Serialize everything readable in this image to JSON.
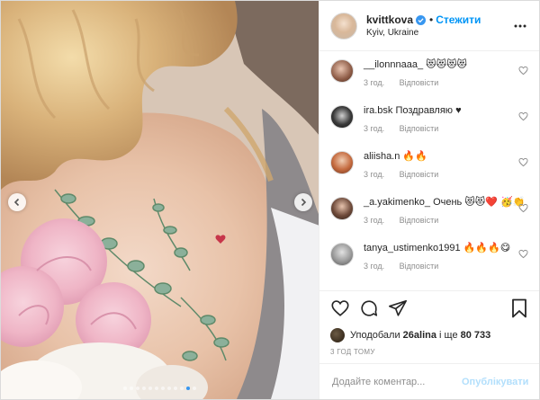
{
  "post": {
    "username": "kvittkova",
    "separator": "•",
    "follow_label": "Стежити",
    "location": "Kyiv, Ukraine",
    "accent": "#0095f6",
    "active_slide": 10,
    "slide_count": 12
  },
  "comments": [
    {
      "user": "__ilonnnaaa_",
      "text": "😻😻😻😻",
      "time": "3 год.",
      "reply": "Відповісти"
    },
    {
      "user": "ira.bsk",
      "text": "Поздравляю ♥",
      "time": "3 год.",
      "reply": "Відповісти"
    },
    {
      "user": "aliisha.n",
      "text": "🔥🔥",
      "time": "3 год.",
      "reply": "Відповісти"
    },
    {
      "user": "_a.yakimenko_",
      "text": "Очень 😻😻❤️ 🥳👏",
      "time": "3 год.",
      "reply": "Відповісти"
    },
    {
      "user": "tanya_ustimenko1991",
      "text": "🔥🔥🔥😋",
      "time": "3 год.",
      "reply": "Відповісти"
    }
  ],
  "likes": {
    "prefix": "Уподобали",
    "user": "26alina",
    "middle": "і ще",
    "count": "80 733"
  },
  "timestamp": "3 ГОД ТОМУ",
  "add_comment": {
    "placeholder": "Додайте коментар...",
    "publish_label": "Опублікувати"
  }
}
